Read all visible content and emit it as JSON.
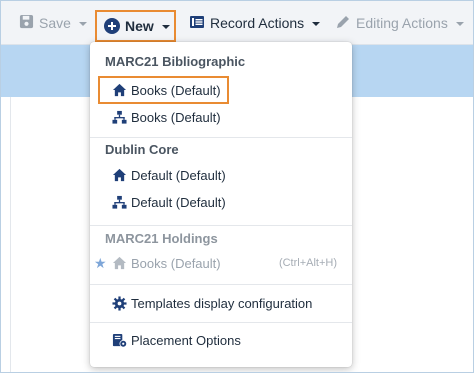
{
  "colors": {
    "accent_orange": "#e98b32",
    "icon_navy": "#1f3f78",
    "band_blue": "#b7d6f2",
    "disabled_gray": "#9aa3ad"
  },
  "toolbar": {
    "save_label": "Save",
    "new_label": "New",
    "record_actions_label": "Record Actions",
    "editing_actions_label": "Editing Actions"
  },
  "menu": {
    "sections": [
      {
        "header": "MARC21 Bibliographic",
        "items": [
          {
            "label": "Books (Default)",
            "icon": "home-icon"
          },
          {
            "label": "Books (Default)",
            "icon": "hierarchy-icon"
          }
        ]
      },
      {
        "header": "Dublin Core",
        "items": [
          {
            "label": "Default (Default)",
            "icon": "home-icon"
          },
          {
            "label": "Default (Default)",
            "icon": "hierarchy-icon"
          }
        ]
      },
      {
        "header": "MARC21 Holdings",
        "items": [
          {
            "label": "Books (Default)",
            "icon": "home-icon",
            "shortcut": "(Ctrl+Alt+H)",
            "disabled": true,
            "favorite_icon": "star-icon"
          }
        ]
      }
    ],
    "templates_config_label": "Templates display configuration",
    "placement_options_label": "Placement Options"
  }
}
